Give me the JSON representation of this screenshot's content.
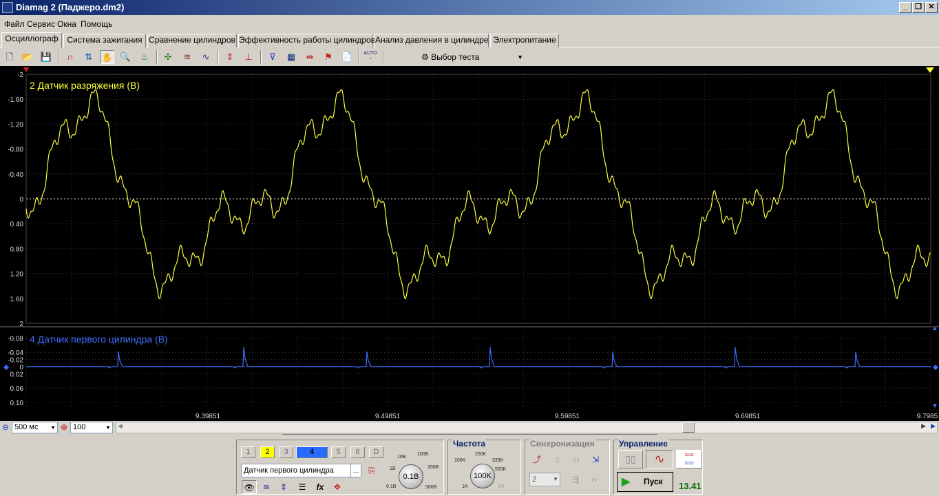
{
  "window": {
    "title": "Diamag 2 (Паджеро.dm2)"
  },
  "menu": [
    "Файл",
    "Сервис",
    "Окна",
    "Помощь"
  ],
  "tabs": [
    "Осциллограф",
    "Система зажигания",
    "Сравнение цилиндров",
    "Эффективность работы цилиндров",
    "Анализ давления в цилиндре",
    "Электропитание"
  ],
  "active_tab": 0,
  "toolbar": {
    "test_select": "Выбор теста",
    "auto_label": "AUTO"
  },
  "channel1": {
    "label": "2 Датчик разряжения (В)",
    "color": "#ffff3c",
    "y_ticks": [
      "-2",
      "-1.60",
      "-1.20",
      "-0.80",
      "-0.40",
      "0",
      "0.40",
      "0.80",
      "1.20",
      "1.60",
      "2"
    ]
  },
  "channel2": {
    "label": "4 Датчик первого цилиндра (В)",
    "color": "#3c6cff",
    "y_ticks": [
      "-0.08",
      "-0.04",
      "-0.02",
      "0",
      "0.02",
      "0.06",
      "0.10"
    ]
  },
  "x_ticks": [
    "9.39851",
    "9.49851",
    "9.59851",
    "9.69851",
    "9.7985"
  ],
  "bottom": {
    "timebase": "500 мс",
    "zoom": "100"
  },
  "panel": {
    "channels": [
      "1",
      "2",
      "3",
      "4",
      "5",
      "6",
      "D"
    ],
    "channel_select": "Датчик первого цилиндра",
    "volt_knob": "0.1В",
    "volt_labels": [
      "10В",
      "100В",
      "1В",
      "200В",
      "0.1В",
      "500В"
    ],
    "freq_title": "Частота",
    "freq_knob": "100K",
    "freq_labels": [
      "250K",
      "100K",
      "333K",
      "500K",
      "1K",
      "1M"
    ],
    "sync_title": "Синхронизация",
    "sync_select": "2",
    "control_title": "Управление",
    "start_label": "Пуск",
    "counter": "13.41"
  }
}
